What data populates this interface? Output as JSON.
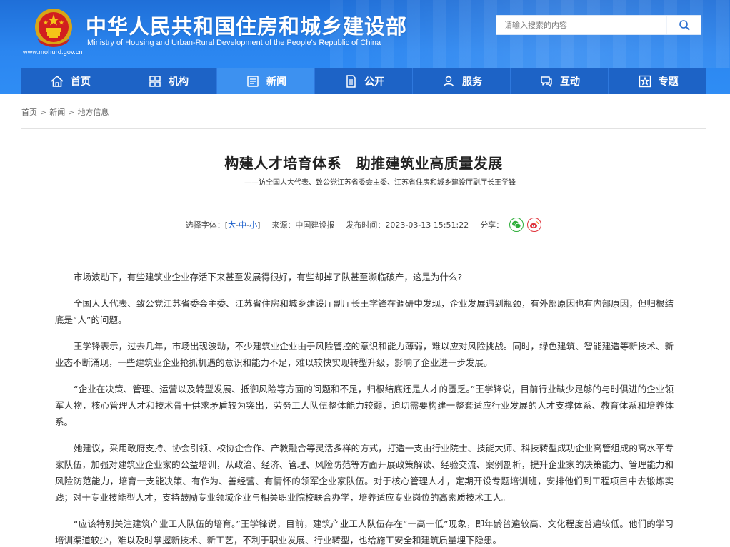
{
  "header": {
    "site_title": "中华人民共和国住房和城乡建设部",
    "site_subtitle": "Ministry of Housing and Urban-Rural Development of the People's Republic of China",
    "site_url": "www.mohurd.gov.cn",
    "search_placeholder": "请输入搜索的内容",
    "colors": {
      "bar": "#2b86f0",
      "nav": "#1d63c6",
      "nav_active": "#3d91f0"
    }
  },
  "nav": {
    "items": [
      {
        "label": "首页",
        "icon": "home-icon"
      },
      {
        "label": "机构",
        "icon": "grid-icon"
      },
      {
        "label": "新闻",
        "icon": "news-icon",
        "active": true
      },
      {
        "label": "公开",
        "icon": "disclosure-icon"
      },
      {
        "label": "服务",
        "icon": "service-icon"
      },
      {
        "label": "互动",
        "icon": "interaction-icon"
      },
      {
        "label": "专题",
        "icon": "star-icon"
      }
    ]
  },
  "breadcrumb": {
    "home": "首页",
    "section": "新闻",
    "current": "地方信息",
    "separator": ">"
  },
  "article": {
    "title": "构建人才培育体系　助推建筑业高质量发展",
    "subtitle": "——访全国人大代表、致公党江苏省委会主委、江苏省住房和城乡建设厅副厅长王学锋",
    "meta": {
      "font_label": "选择字体：",
      "font_open": "[",
      "font_large": "大",
      "font_dash1": "-",
      "font_medium": "中",
      "font_dash2": "-",
      "font_small": "小",
      "font_close": "]",
      "source_label": "来源：",
      "source": "中国建设报",
      "time_label": "发布时间：",
      "time": "2023-03-13 15:51:22",
      "share_label": "分享："
    },
    "paragraphs": [
      "市场波动下，有些建筑业企业存活下来甚至发展得很好，有些却掉了队甚至濒临破产，这是为什么?",
      "全国人大代表、致公党江苏省委会主委、江苏省住房和城乡建设厅副厅长王学锋在调研中发现，企业发展遇到瓶颈，有外部原因也有内部原因，但归根结底是“人”的问题。",
      "王学锋表示，过去几年，市场出现波动，不少建筑业企业由于风险管控的意识和能力薄弱，难以应对风险挑战。同时，绿色建筑、智能建造等新技术、新业态不断涌现，一些建筑业企业抢抓机遇的意识和能力不足，难以较快实现转型升级，影响了企业进一步发展。",
      "“企业在决策、管理、运营以及转型发展、抵御风险等方面的问题和不足，归根结底还是人才的匮乏。”王学锋说，目前行业缺少足够的与时俱进的企业领军人物，核心管理人才和技术骨干供求矛盾较为突出，劳务工人队伍整体能力较弱，迫切需要构建一整套适应行业发展的人才支撑体系、教育体系和培养体系。",
      "她建议，采用政府支持、协会引领、校协企合作、产教融合等灵活多样的方式，打造一支由行业院士、技能大师、科技转型成功企业高管组成的高水平专家队伍，加强对建筑业企业家的公益培训，从政治、经济、管理、风险防范等方面开展政策解读、经验交流、案例剖析，提升企业家的决策能力、管理能力和风险防范能力，培育一支能决策、有作为、善经营、有情怀的领军企业家队伍。对于核心管理人才，定期开设专题培训班，安排他们到工程项目中去锻炼实践；对于专业技能型人才，支持鼓励专业领域企业与相关职业院校联合办学，培养适应专业岗位的高素质技术工人。",
      "“应该特别关注建筑产业工人队伍的培育。”王学锋说，目前，建筑产业工人队伍存在“一高一低”现象，即年龄普遍较高、文化程度普遍较低。他们的学习培训渠道较少，难以及时掌握新技术、新工艺，不利于职业发展、行业转型，也给施工安全和建筑质量埋下隐患。"
    ]
  }
}
